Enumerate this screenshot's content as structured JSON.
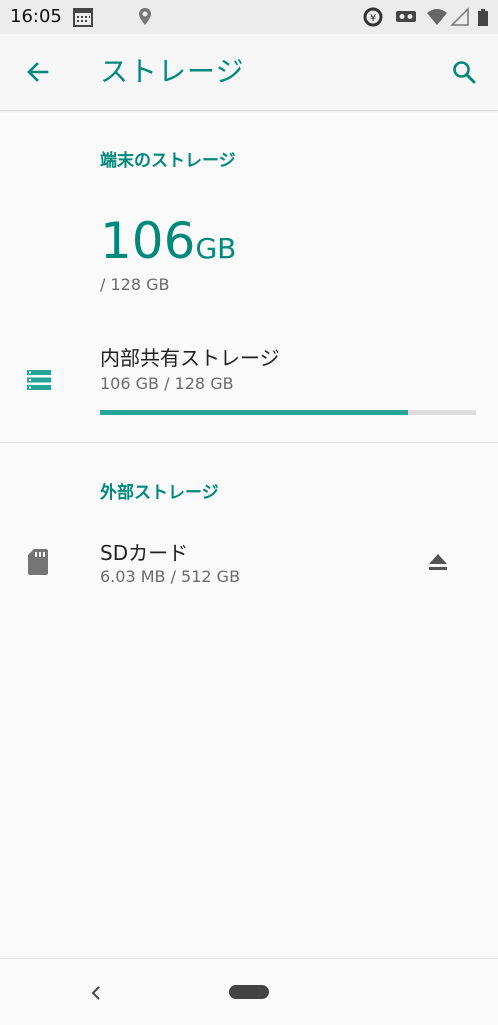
{
  "status_bar": {
    "time": "16:05",
    "icons": [
      "calendar-icon",
      "location-icon",
      "data-saver-icon",
      "vr-icon",
      "wifi-icon",
      "signal-icon",
      "battery-icon"
    ]
  },
  "app_bar": {
    "title": "ストレージ",
    "back_icon": "arrow-back-icon",
    "search_icon": "search-icon"
  },
  "device_storage": {
    "header": "端末のストレージ",
    "used_value": "106",
    "used_unit": "GB",
    "total_label": "/ 128 GB",
    "internal": {
      "title": "内部共有ストレージ",
      "summary": "106 GB / 128 GB",
      "used_fraction": 0.82,
      "icon": "storage-icon"
    }
  },
  "external_storage": {
    "header": "外部ストレージ",
    "sd_card": {
      "title": "SDカード",
      "summary": "6.03 MB / 512 GB",
      "icon": "sd-card-icon",
      "action_icon": "eject-icon"
    }
  },
  "colors": {
    "accent": "#00897b",
    "progress": "#26a69a"
  },
  "nav_bar": {
    "back_icon": "nav-back-icon",
    "home_icon": "nav-home-pill"
  }
}
